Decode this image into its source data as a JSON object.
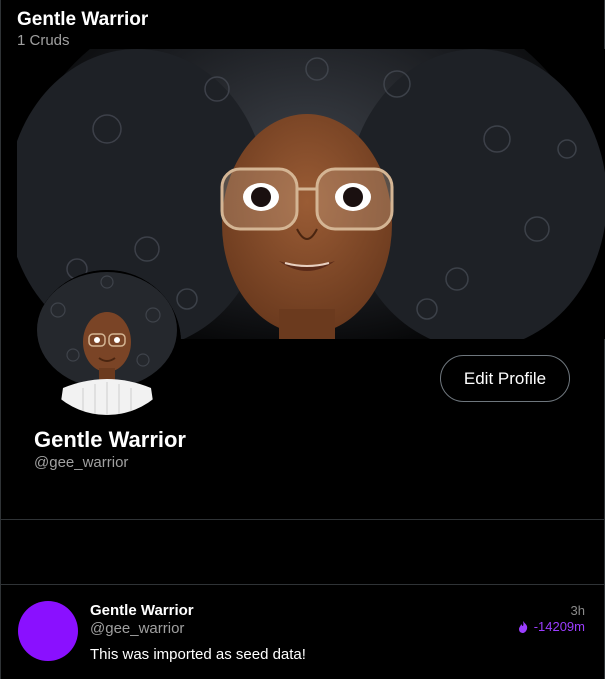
{
  "header": {
    "title": "Gentle Warrior",
    "count": "1 Cruds"
  },
  "profile": {
    "name": "Gentle Warrior",
    "handle": "@gee_warrior",
    "edit_label": "Edit Profile",
    "banner_icon": "afro-woman-illustration",
    "avatar_icon": "afro-woman-avatar"
  },
  "posts": [
    {
      "name": "Gentle Warrior",
      "handle": "@gee_warrior",
      "text": "This was imported as seed data!",
      "time": "3h",
      "expires": "-14209m",
      "avatar_color": "#8a10ff",
      "expire_icon": "flame-icon"
    }
  ],
  "colors": {
    "accent": "#9b3dff",
    "background": "#000000",
    "muted": "#a0a0a0"
  }
}
